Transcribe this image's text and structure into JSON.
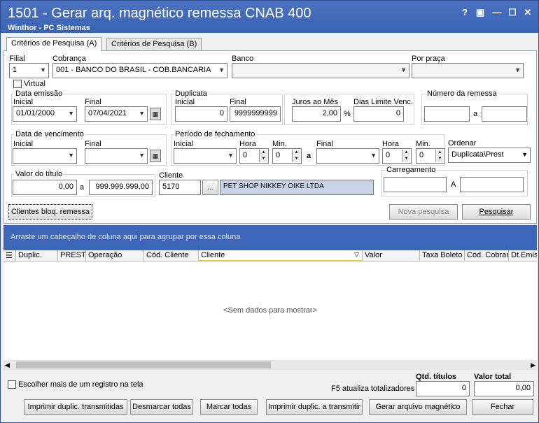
{
  "window": {
    "title": "1501 - Gerar arq. magnético remessa CNAB 400",
    "subtitle": "Winthor - PC Sistemas",
    "buttons": [
      "?",
      "▣",
      "—",
      "☐",
      "✕"
    ]
  },
  "tabs": [
    {
      "label": "Critérios de Pesquisa (A)",
      "active": true
    },
    {
      "label": "Critérios de Pesquisa (B)",
      "active": false
    }
  ],
  "filters": {
    "filial": {
      "label": "Filial",
      "value": "1"
    },
    "cobranca": {
      "label": "Cobrança",
      "value": "001 - BANCO DO BRASIL - COB.BANCARIA"
    },
    "banco": {
      "label": "Banco",
      "value": ""
    },
    "por_praca": {
      "label": "Por praça",
      "value": ""
    },
    "virtual": {
      "label": "Virtual",
      "checked": false
    },
    "data_emissao": {
      "label": "Data emissão",
      "inicial_label": "Inicial",
      "final_label": "Final",
      "inicial": "01/01/2000",
      "final": "07/04/2021"
    },
    "duplicata": {
      "label": "Duplicata",
      "inicial_label": "Inicial",
      "final_label": "Final",
      "inicial": "0",
      "final": "9999999999"
    },
    "juros": {
      "label": "Juros ao Mês",
      "value": "2,00",
      "unit": "%"
    },
    "dias_limite": {
      "label": "Dias Limite Venc.",
      "value": "0"
    },
    "numero_remessa": {
      "label": "Número da remessa",
      "sep": "a",
      "inicial": "",
      "final": ""
    },
    "data_vencimento": {
      "label": "Data de vencimento",
      "inicial_label": "Inicial",
      "final_label": "Final",
      "inicial": "",
      "final": ""
    },
    "periodo_fechamento": {
      "label": "Período de fechamento",
      "inicial_label": "Inicial",
      "hora_label": "Hora",
      "min_label": "Min.",
      "sep": "a",
      "final_label": "Final",
      "hora1": "0",
      "min1": "0",
      "hora2": "0",
      "min2": "0"
    },
    "ordenar": {
      "label": "Ordenar",
      "value": "Duplicata\\Prest"
    },
    "valor_titulo": {
      "label": "Valor do título",
      "sep": "a",
      "inicial": "0,00",
      "final": "999.999.999,00"
    },
    "cliente": {
      "label": "Cliente",
      "code": "5170",
      "btn": "...",
      "name": "PET SHOP NIKKEY OIKE LTDA"
    },
    "carregamento": {
      "label": "Carregamento",
      "sep": "A",
      "inicial": "",
      "final": ""
    }
  },
  "actions": {
    "clientes_bloq": "Clientes bloq. remessa",
    "nova_pesquisa": "Nova pesquisa",
    "pesquisar": "Pesquisar"
  },
  "grid": {
    "group_hint": "Arraste um cabeçalho de coluna aqui para agrupar por essa coluna",
    "columns": [
      "Duplic.",
      "PREST",
      "Operação",
      "Cód. Cliente",
      "Cliente",
      "Valor",
      "Taxa Boleto",
      "Cód. Cobrar",
      "Dt.Emis"
    ],
    "empty_text": "<Sem dados para mostrar>"
  },
  "footer": {
    "escolher": "Escolher mais de um registro na tela",
    "f5": "F5 atualiza totalizadores",
    "qtd_label": "Qtd. títulos",
    "qtd": "0",
    "valor_label": "Valor total",
    "valor": "0,00",
    "buttons": [
      "Imprimir duplic. transmitidas",
      "Desmarcar todas",
      "Marcar todas",
      "Imprimir duplic. a transmitir",
      "Gerar arquivo magnético",
      "Fechar"
    ]
  }
}
